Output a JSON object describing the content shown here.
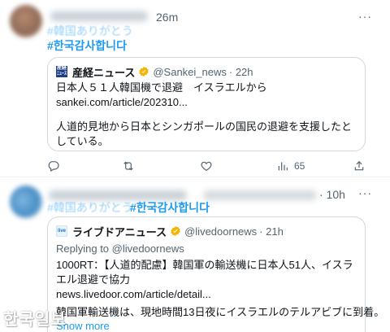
{
  "tweet1": {
    "time": "26m",
    "more": "···",
    "hashtag_ja": "#韓国ありがとう",
    "hashtag_ko": "#한국감사합니다",
    "quote": {
      "name": "産経ニュース",
      "handle": "@Sankei_news",
      "time": "· 22h",
      "logo_text": "産経\nニュース",
      "line1": "日本人５１人韓国機で退避　イスラエルから",
      "link": "sankei.com/article/202310...",
      "body": "人道的見地から日本とシンガポールの国民の退避を支援したとしている。"
    },
    "actions": {
      "reply_icon": "reply-icon",
      "retweet_icon": "retweet-icon",
      "like_icon": "like-icon",
      "views_icon": "views-icon",
      "views_count": "65",
      "share_icon": "share-icon"
    }
  },
  "tweet2": {
    "time": "· 10h",
    "hashtag_ja": "#韓国ありがとう",
    "hashtag_ko": "#한국감사합니다",
    "quote": {
      "name": "ライブドアニュース",
      "handle": "@livedoornews",
      "time": "· 21h",
      "logo_text": "live",
      "replying": "Replying to @livedoornews",
      "body": "1000RT：【人道的配慮】韓国軍の輸送機に日本人51人、イスラエル退避で協力",
      "link": "news.livedoor.com/article/detail...",
      "body2": "韓国軍輸送機は、現地時間13日夜にイスラエルのテルアビブに到着。",
      "show_more": "Show more"
    }
  },
  "watermark": "한국일보",
  "colors": {
    "link": "#1d9bf0",
    "muted": "#536471",
    "border": "#cfd9de",
    "verified": "#f4b400"
  }
}
